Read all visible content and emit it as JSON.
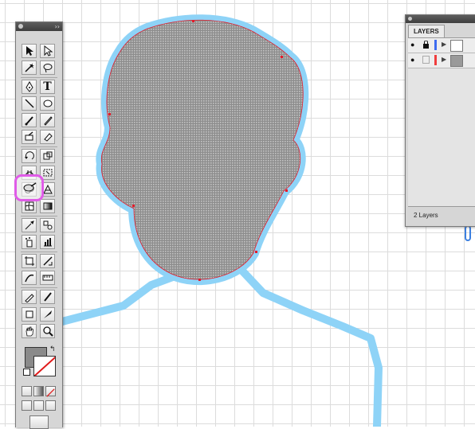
{
  "tools_panel": {
    "collapse_arrows": "››",
    "type_tool_label": "T",
    "swap_icon": "↰"
  },
  "layers_panel": {
    "tab_label": "LAYERS",
    "layer_count": "2 Layers",
    "layers": [
      {
        "visible": true,
        "locked": true,
        "color": "#3d6bf0"
      },
      {
        "visible": true,
        "locked": false,
        "color": "#f03d3d"
      }
    ]
  },
  "colors": {
    "selection_glow": "#8ed3f7",
    "anchor_point": "#e31b2b",
    "silhouette_fill": "#9a9a9a",
    "highlight_ring": "#e05ce8",
    "fill_swatch": "#8a8a8a"
  }
}
